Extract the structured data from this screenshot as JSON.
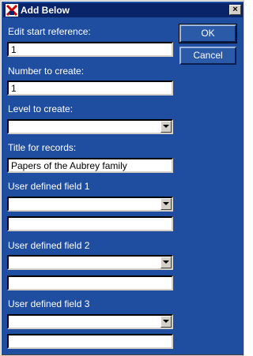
{
  "window": {
    "title": "Add Below",
    "close_label": "×"
  },
  "buttons": {
    "ok_label": "OK",
    "cancel_label": "Cancel"
  },
  "form": {
    "edit_start_reference": {
      "label": "Edit start reference:",
      "value": "1"
    },
    "number_to_create": {
      "label": "Number to create:",
      "value": "1"
    },
    "level_to_create": {
      "label": "Level to create:",
      "value": ""
    },
    "title_for_records": {
      "label": "Title for records:",
      "value": "Papers of the Aubrey family"
    },
    "user_field_1": {
      "label": "User defined field 1",
      "combo_value": "",
      "text_value": ""
    },
    "user_field_2": {
      "label": "User defined field 2",
      "combo_value": "",
      "text_value": ""
    },
    "user_field_3": {
      "label": "User defined field 3",
      "combo_value": "",
      "text_value": ""
    }
  },
  "colors": {
    "dialog_background": "#1f4ea1",
    "titlebar": "#0a246a"
  },
  "icons": {
    "app": "calmview-app-icon",
    "combo_arrow": "chevron-down-icon"
  }
}
